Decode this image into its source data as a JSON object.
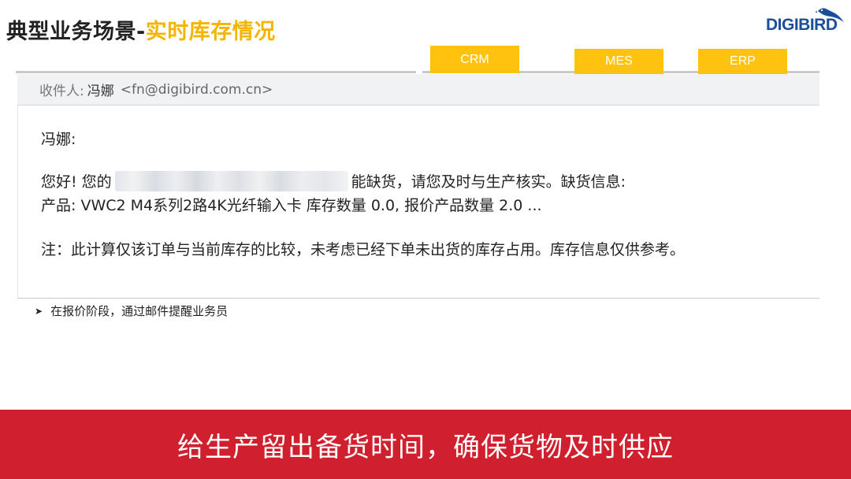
{
  "header": {
    "title_main": "典型业务场景-",
    "title_accent": "实时库存情况"
  },
  "logo": {
    "text": "DIGIBIRD",
    "icon": "bird-icon",
    "color": "#1a4f9c"
  },
  "tags": {
    "crm": "CRM",
    "mes": "MES",
    "erp": "ERP",
    "color": "#ffc20e"
  },
  "email": {
    "to_label": "收件人:",
    "to_name": "冯娜",
    "to_address": "<fn@digibird.com.cn>",
    "greeting": "冯娜:",
    "hello_prefix": "您好! 您的",
    "hello_suffix": "能缺货，请您及时与生产核实。缺货信息:",
    "product_line": "产品: VWC2 M4系列2路4K光纤输入卡 库存数量 0.0, 报价产品数量 2.0 ...",
    "note_line": "注：此计算仅该订单与当前库存的比较，未考虑已经下单未出货的库存占用。库存信息仅供参考。"
  },
  "bullet": {
    "icon": "arrow-bullet-icon",
    "text": "在报价阶段，通过邮件提醒业务员"
  },
  "banner": {
    "text": "给生产留出备货时间，确保货物及时供应",
    "color": "#d0202e"
  }
}
